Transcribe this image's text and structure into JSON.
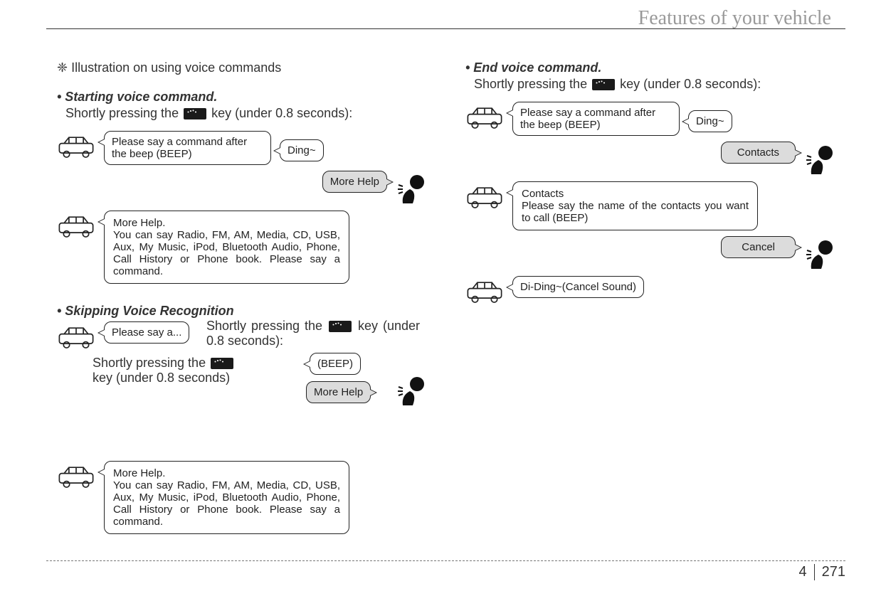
{
  "header": {
    "title": "Features of your vehicle"
  },
  "intro": "❈ Illustration on using voice commands",
  "sections": {
    "start": {
      "heading": "• Starting voice command.",
      "sub": "Shortly pressing the {KEY} key (under 0.8 seconds):",
      "bubble1": "Please say a command after the beep (BEEP)",
      "ding": "Ding~",
      "morehelp_btn": "More Help",
      "bubble2_title": "More Help.",
      "bubble2_body": "You can say Radio, FM, AM, Media, CD, USB, Aux, My Music, iPod, Bluetooth Audio, Phone, Call History or Phone book. Please say a command."
    },
    "skip": {
      "heading": "• Skipping Voice Recognition",
      "please": "Please say a...",
      "text1_pre": "Shortly pressing the ",
      "text1_post": " key (under 0.8 seconds):",
      "text2_pre": "Shortly pressing the ",
      "text2_post": " key (under 0.8 seconds)",
      "beep": "(BEEP)",
      "morehelp_btn": "More Help",
      "bubble2_title": "More Help.",
      "bubble2_body": "You can say Radio, FM, AM, Media, CD, USB, Aux, My Music, iPod, Bluetooth Audio, Phone, Call History or Phone book. Please say a command."
    },
    "end": {
      "heading": "• End voice command.",
      "sub": "Shortly pressing the {KEY} key (under 0.8 seconds):",
      "bubble1": "Please say a command after the beep (BEEP)",
      "ding": "Ding~",
      "contacts_btn": "Contacts",
      "bubble2_title": "Contacts",
      "bubble2_body": "Please say the name of the contacts you want to call (BEEP)",
      "cancel_btn": "Cancel",
      "cancel_sound": "Di-Ding~(Cancel Sound)"
    }
  },
  "footer": {
    "chapter": "4",
    "page": "271"
  }
}
